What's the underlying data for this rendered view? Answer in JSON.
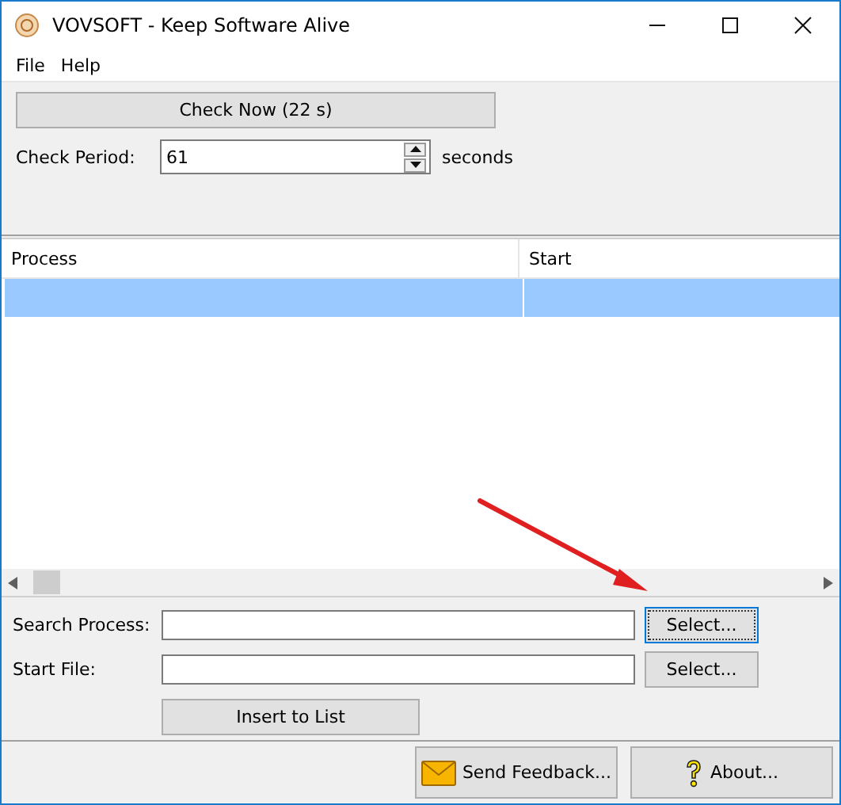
{
  "window": {
    "title": "VOVSOFT - Keep Software Alive"
  },
  "menu": [
    "File",
    "Help"
  ],
  "check_button": "Check Now (22 s)",
  "check_period": {
    "label": "Check Period:",
    "value": "61",
    "unit": "seconds"
  },
  "table": {
    "columns": [
      "Process",
      "Start"
    ],
    "rows": [
      {
        "selected": true
      }
    ]
  },
  "search_process": {
    "label": "Search Process:",
    "button": "Select...",
    "focused": true
  },
  "start_file": {
    "label": "Start File:",
    "button": "Select...",
    "focused": false
  },
  "insert_button": "Insert to List",
  "footer_buttons": [
    {
      "kind": "feedback",
      "label": "Send Feedback..."
    },
    {
      "kind": "about",
      "label": "About..."
    }
  ],
  "annotation": {
    "kind": "arrow"
  }
}
